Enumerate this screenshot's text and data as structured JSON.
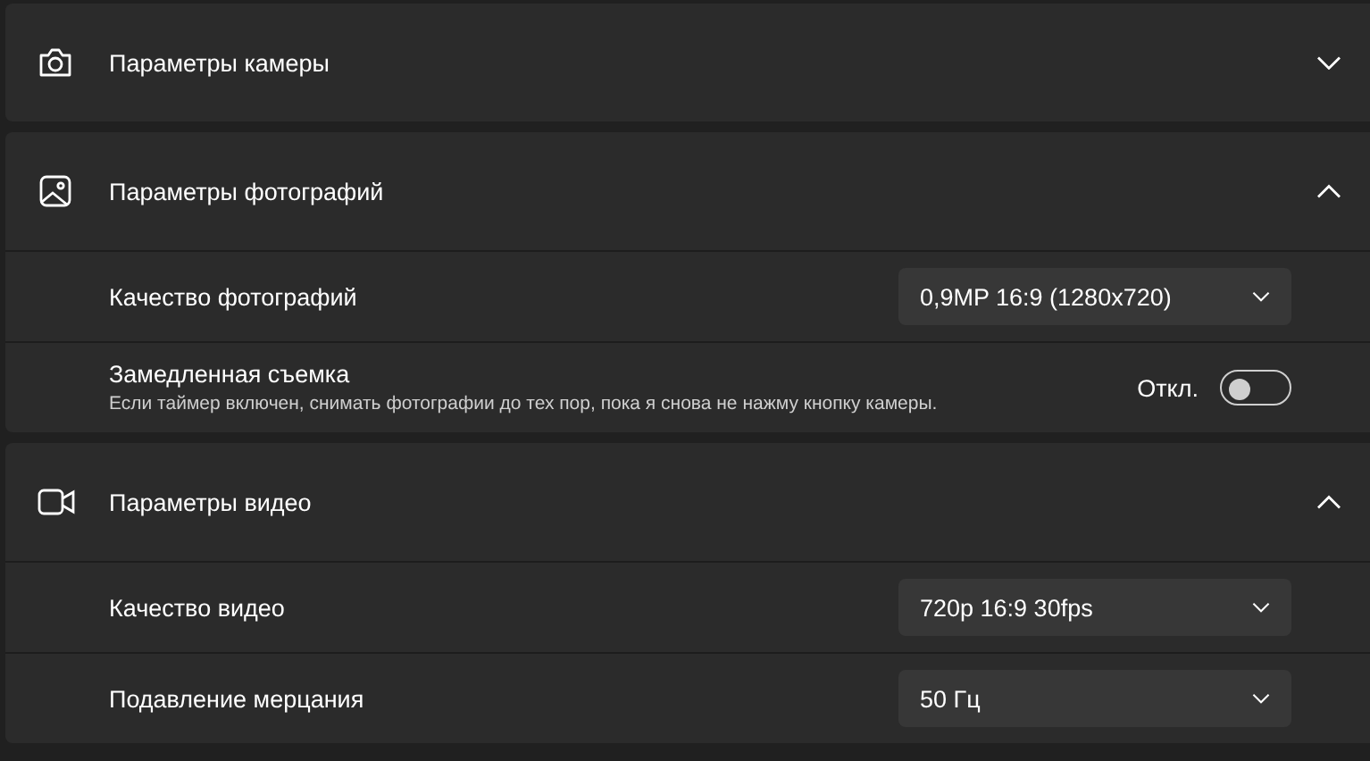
{
  "sections": [
    {
      "title": "Параметры камеры",
      "expanded": false
    },
    {
      "title": "Параметры фотографий",
      "expanded": true,
      "settings": [
        {
          "kind": "dropdown",
          "label": "Качество фотографий",
          "value": "0,9MP 16:9 (1280x720)"
        },
        {
          "kind": "toggle",
          "label": "Замедленная съемка",
          "description": "Если таймер включен, снимать фотографии до тех пор, пока я снова не нажму кнопку камеры.",
          "state_text": "Откл.",
          "on": false
        }
      ]
    },
    {
      "title": "Параметры видео",
      "expanded": true,
      "settings": [
        {
          "kind": "dropdown",
          "label": "Качество видео",
          "value": "720p 16:9 30fps"
        },
        {
          "kind": "dropdown",
          "label": "Подавление мерцания",
          "value": "50 Гц"
        }
      ]
    }
  ]
}
